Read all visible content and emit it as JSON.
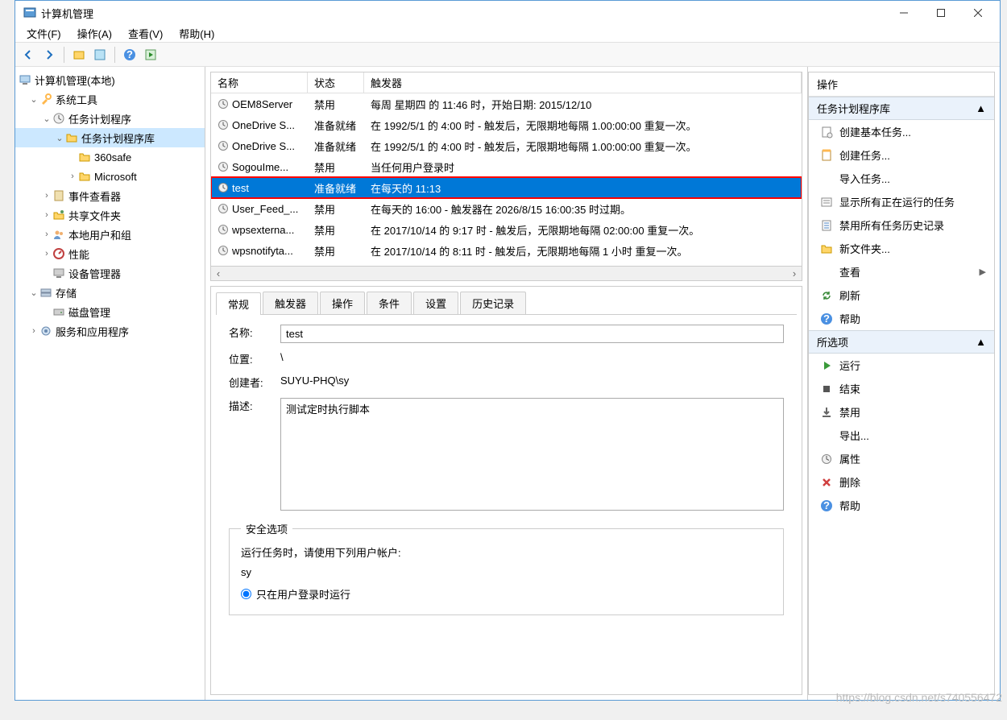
{
  "window": {
    "title": "计算机管理"
  },
  "menubar": [
    "文件(F)",
    "操作(A)",
    "查看(V)",
    "帮助(H)"
  ],
  "tree": {
    "root": "计算机管理(本地)",
    "systools": "系统工具",
    "task_scheduler": "任务计划程序",
    "task_library": "任务计划程序库",
    "lib_360safe": "360safe",
    "lib_microsoft": "Microsoft",
    "event_viewer": "事件查看器",
    "shared_folders": "共享文件夹",
    "local_users": "本地用户和组",
    "performance": "性能",
    "device_manager": "设备管理器",
    "storage": "存储",
    "disk_mgmt": "磁盘管理",
    "services_apps": "服务和应用程序"
  },
  "task_columns": {
    "name": "名称",
    "status": "状态",
    "trigger": "触发器"
  },
  "tasks": [
    {
      "name": "OEM8Server",
      "status": "禁用",
      "trigger": "每周 星期四 的 11:46 时，开始日期: 2015/12/10"
    },
    {
      "name": "OneDrive S...",
      "status": "准备就绪",
      "trigger": "在 1992/5/1 的 4:00 时 - 触发后，无限期地每隔 1.00:00:00 重复一次。"
    },
    {
      "name": "OneDrive S...",
      "status": "准备就绪",
      "trigger": "在 1992/5/1 的 4:00 时 - 触发后，无限期地每隔 1.00:00:00 重复一次。"
    },
    {
      "name": "SogouIme...",
      "status": "禁用",
      "trigger": "当任何用户登录时"
    },
    {
      "name": "test",
      "status": "准备就绪",
      "trigger": "在每天的 11:13",
      "selected": true
    },
    {
      "name": "User_Feed_...",
      "status": "禁用",
      "trigger": "在每天的 16:00 - 触发器在 2026/8/15 16:00:35 时过期。"
    },
    {
      "name": "wpsexterna...",
      "status": "禁用",
      "trigger": "在 2017/10/14 的 9:17 时 - 触发后，无限期地每隔 02:00:00 重复一次。"
    },
    {
      "name": "wpsnotifyta...",
      "status": "禁用",
      "trigger": "在 2017/10/14 的 8:11 时 - 触发后，无限期地每隔 1 小时 重复一次。"
    }
  ],
  "detail_tabs": [
    "常规",
    "触发器",
    "操作",
    "条件",
    "设置",
    "历史记录"
  ],
  "detail": {
    "name_label": "名称:",
    "name_value": "test",
    "location_label": "位置:",
    "location_value": "\\",
    "author_label": "创建者:",
    "author_value": "SUYU-PHQ\\sy",
    "desc_label": "描述:",
    "desc_value": "测试定时执行脚本",
    "security_legend": "安全选项",
    "security_text": "运行任务时，请使用下列用户帐户:",
    "security_user": "sy",
    "radio1": "只在用户登录时运行"
  },
  "actions_panel": {
    "title": "操作",
    "section1": "任务计划程序库",
    "items1": [
      "创建基本任务...",
      "创建任务...",
      "导入任务...",
      "显示所有正在运行的任务",
      "禁用所有任务历史记录",
      "新文件夹...",
      "查看",
      "刷新",
      "帮助"
    ],
    "section2": "所选项",
    "items2": [
      "运行",
      "结束",
      "禁用",
      "导出...",
      "属性",
      "删除",
      "帮助"
    ]
  },
  "watermark": "https://blog.csdn.net/s740556472"
}
